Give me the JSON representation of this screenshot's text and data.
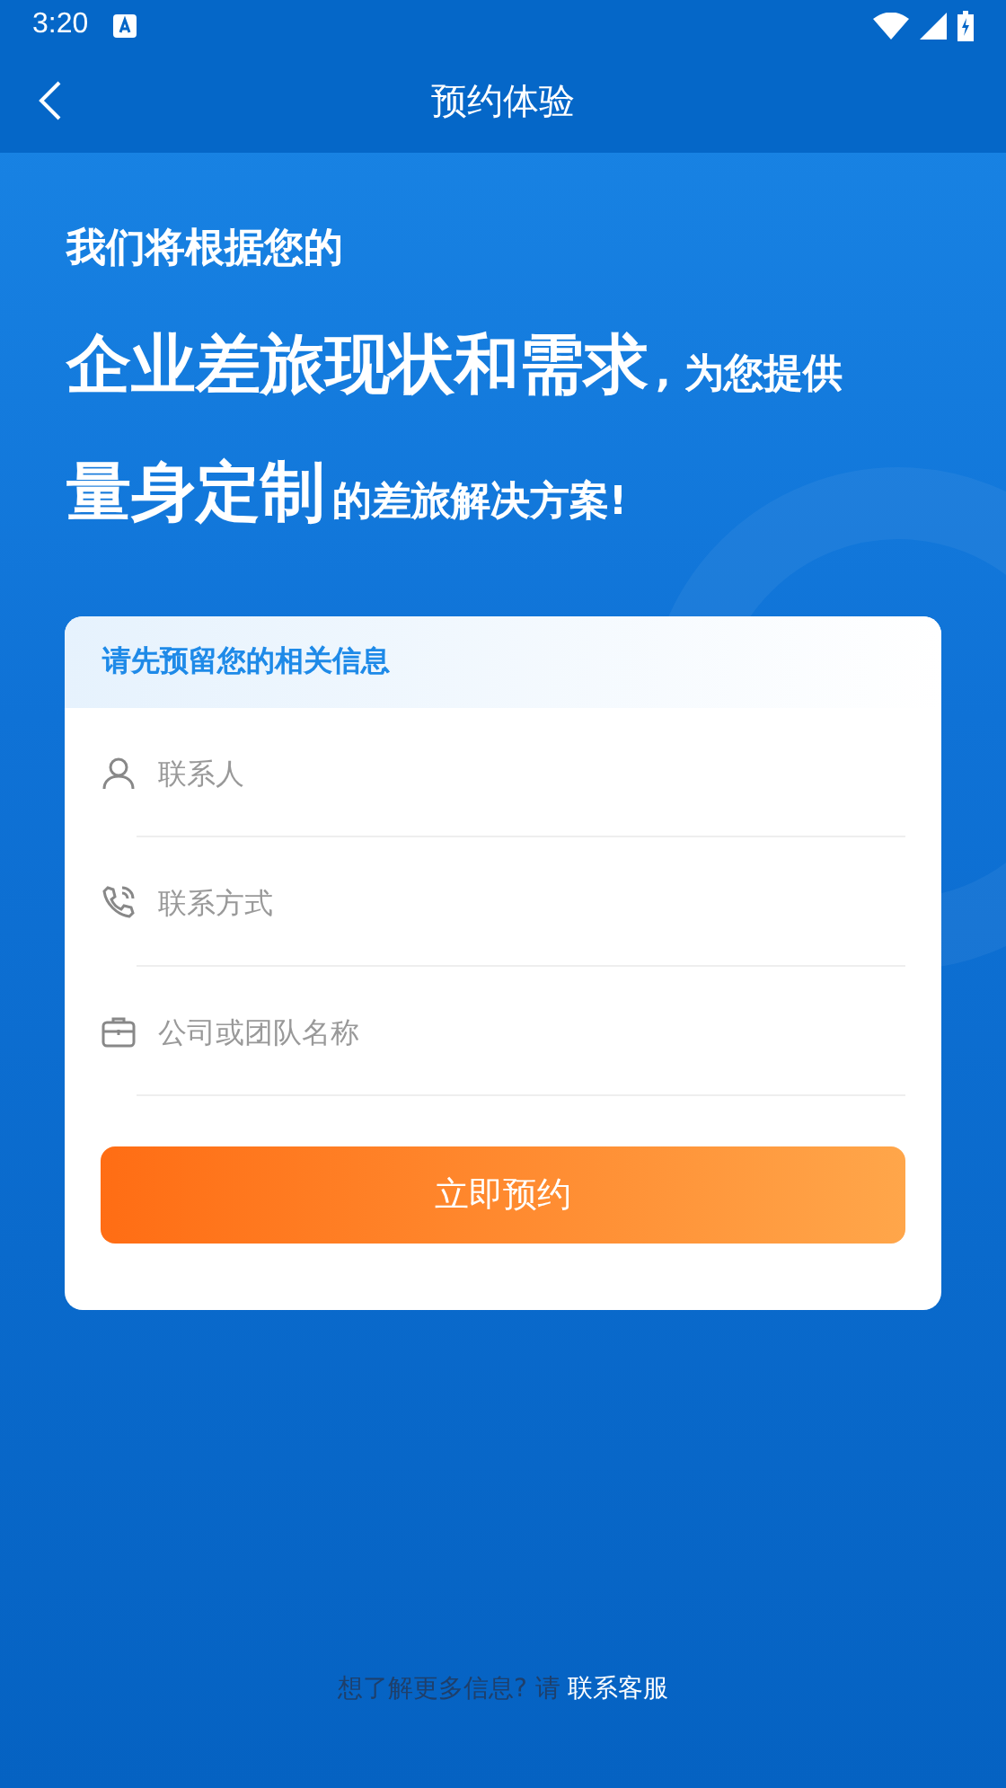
{
  "status_bar": {
    "time": "3:20"
  },
  "header": {
    "title": "预约体验"
  },
  "banner": {
    "line_1": "我们将根据您的",
    "line_2_main": "企业差旅现状和需求",
    "line_2_rest": ", 为您提供",
    "line_3_main": "量身定制",
    "line_3_rest": "的差旅解决方案!"
  },
  "form": {
    "title": "请先预留您的相关信息",
    "fields": [
      {
        "kind": "person",
        "placeholder": "联系人"
      },
      {
        "kind": "phone",
        "placeholder": "联系方式"
      },
      {
        "kind": "briefcase",
        "placeholder": "公司或团队名称"
      }
    ],
    "submit": "立即预约"
  },
  "footer": {
    "text": "想了解更多信息? 请",
    "link": "联系客服"
  }
}
